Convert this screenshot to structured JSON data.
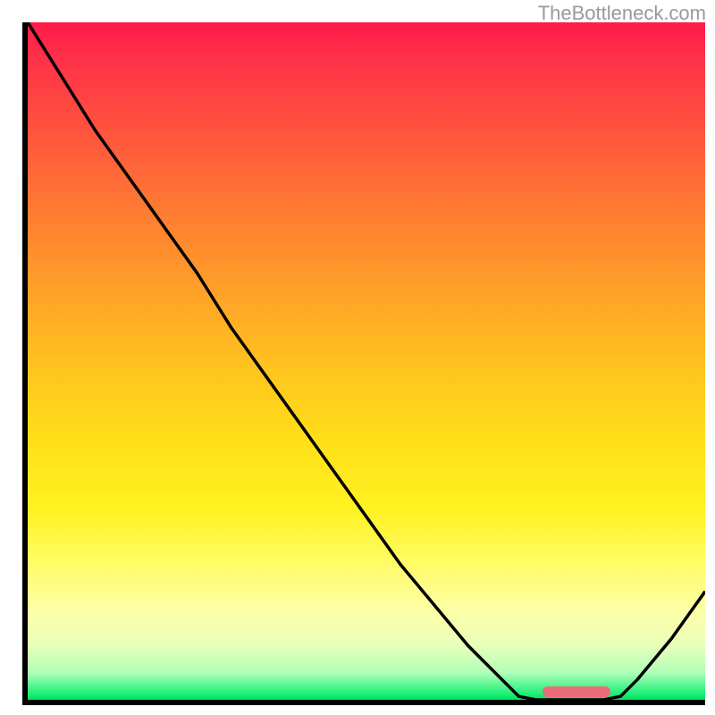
{
  "watermark_text": "TheBottleneck.com",
  "chart_data": {
    "type": "line",
    "title": "",
    "xlabel": "",
    "ylabel": "",
    "x": [
      0.0,
      0.05,
      0.1,
      0.15,
      0.2,
      0.25,
      0.3,
      0.35,
      0.4,
      0.45,
      0.5,
      0.55,
      0.6,
      0.65,
      0.7,
      0.725,
      0.75,
      0.8,
      0.85,
      0.875,
      0.9,
      0.95,
      1.0
    ],
    "values": [
      1.0,
      0.92,
      0.84,
      0.77,
      0.7,
      0.63,
      0.55,
      0.48,
      0.41,
      0.34,
      0.27,
      0.2,
      0.14,
      0.08,
      0.03,
      0.005,
      0.0,
      0.0,
      0.0,
      0.005,
      0.03,
      0.09,
      0.16
    ],
    "xlim": [
      0,
      1
    ],
    "ylim": [
      0,
      1
    ],
    "marker": {
      "x_start": 0.76,
      "x_end": 0.86,
      "y": 0.0
    },
    "note": "Curve interpreted against plot area; y=0 at bottom, y=1 at top. Initial segment steeper then near-linear descent to a flat valley ~0.73–0.87, then rises again."
  },
  "colors": {
    "axis": "#000000",
    "curve": "#000000",
    "marker": "#e96e7a",
    "watermark": "#98999a"
  }
}
